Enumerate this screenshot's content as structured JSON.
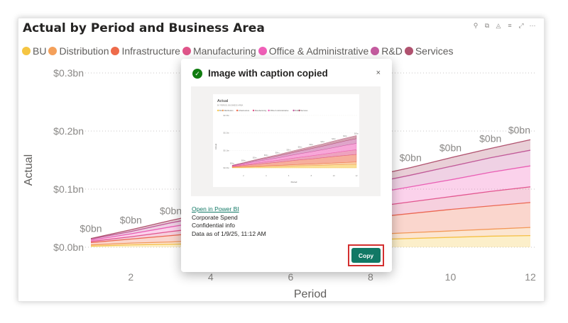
{
  "visual": {
    "title": "Actual by Period and Business Area",
    "header_icons": [
      "pin-icon",
      "copy-icon",
      "bell-icon",
      "filter-icon",
      "focus-mode-icon",
      "more-options-icon"
    ]
  },
  "legend": {
    "items": [
      {
        "label": "BU",
        "color": "#f5c542"
      },
      {
        "label": "Distribution",
        "color": "#f4a05a"
      },
      {
        "label": "Infrastructure",
        "color": "#ee6b4b"
      },
      {
        "label": "Manufacturing",
        "color": "#e0558a"
      },
      {
        "label": "Office & Administrative",
        "color": "#f05fb8"
      },
      {
        "label": "R&D",
        "color": "#c45b9f"
      },
      {
        "label": "Services",
        "color": "#b0526f"
      }
    ]
  },
  "chart_data": {
    "type": "area",
    "stacked": true,
    "title": "Actual by Period and Business Area",
    "xlabel": "Period",
    "ylabel": "Actual",
    "x_ticks": [
      "2",
      "4",
      "6",
      "8",
      "10",
      "12"
    ],
    "y_ticks": [
      "$0.0bn",
      "$0.1bn",
      "$0.2bn",
      "$0.3bn"
    ],
    "ylim": [
      0,
      0.3
    ],
    "xlim": [
      0.5,
      12
    ],
    "grid": true,
    "data_labels": [
      "$0bn",
      "$0bn",
      "$0bn",
      "$0bn",
      "$0bn",
      "$0bn",
      "$0bn",
      "$0bn",
      "$0bn",
      "$0bn",
      "$0bn",
      "$0bn"
    ],
    "x": [
      1,
      2,
      3,
      4,
      5,
      6,
      7,
      8,
      9,
      10,
      11,
      12
    ],
    "series": [
      {
        "name": "BU",
        "color": "#f5c542",
        "values": [
          0.002,
          0.004,
          0.005,
          0.007,
          0.008,
          0.01,
          0.012,
          0.013,
          0.015,
          0.017,
          0.019,
          0.02
        ]
      },
      {
        "name": "Distribution",
        "color": "#f4a05a",
        "values": [
          0.002,
          0.003,
          0.004,
          0.005,
          0.006,
          0.007,
          0.008,
          0.009,
          0.01,
          0.011,
          0.012,
          0.014
        ]
      },
      {
        "name": "Infrastructure",
        "color": "#ee6b4b",
        "values": [
          0.004,
          0.007,
          0.011,
          0.014,
          0.018,
          0.022,
          0.026,
          0.029,
          0.033,
          0.037,
          0.04,
          0.043
        ]
      },
      {
        "name": "Manufacturing",
        "color": "#e0558a",
        "values": [
          0.002,
          0.004,
          0.007,
          0.009,
          0.011,
          0.013,
          0.015,
          0.018,
          0.02,
          0.022,
          0.025,
          0.027
        ]
      },
      {
        "name": "Office & Administrative",
        "color": "#f05fb8",
        "values": [
          0.002,
          0.005,
          0.008,
          0.011,
          0.014,
          0.017,
          0.02,
          0.023,
          0.026,
          0.029,
          0.033,
          0.036
        ]
      },
      {
        "name": "R&D",
        "color": "#c45b9f",
        "values": [
          0.002,
          0.004,
          0.007,
          0.009,
          0.011,
          0.013,
          0.016,
          0.018,
          0.02,
          0.023,
          0.025,
          0.027
        ]
      },
      {
        "name": "Services",
        "color": "#b0526f",
        "values": [
          0.001,
          0.003,
          0.004,
          0.006,
          0.007,
          0.009,
          0.01,
          0.012,
          0.013,
          0.015,
          0.016,
          0.018
        ]
      }
    ]
  },
  "dialog": {
    "title": "Image with caption copied",
    "close_label": "×",
    "open_link": "Open in Power BI",
    "report_name": "Corporate Spend",
    "sensitivity": "Confidential info",
    "data_as_of": "Data as of 1/9/25, 11:12 AM",
    "copy_label": "Copy",
    "thumbnail": {
      "title": "Actual",
      "subtitle": "BY PERIOD, BUSINESS AREA",
      "legend": [
        "BU",
        "Distribution",
        "Infrastructure",
        "Manufacturing",
        "Office & Administrative",
        "R&D",
        "Services"
      ],
      "y_ticks": [
        "$0.0bn",
        "$0.1bn",
        "$0.2bn",
        "$0.3bn"
      ],
      "x_ticks": [
        "2",
        "4",
        "6",
        "8",
        "10",
        "12"
      ],
      "ylabel": "Actual",
      "xlabel": "Period"
    }
  }
}
